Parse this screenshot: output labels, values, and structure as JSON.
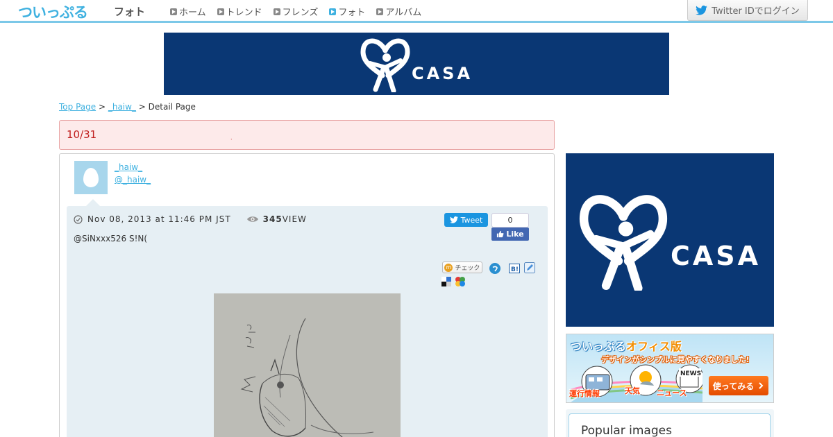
{
  "header": {
    "logo": "ついっぷる",
    "section": "フォト",
    "nav": [
      {
        "label": "ホーム",
        "active": false
      },
      {
        "label": "トレンド",
        "active": false
      },
      {
        "label": "フレンズ",
        "active": false
      },
      {
        "label": "フォト",
        "active": true
      },
      {
        "label": "アルバム",
        "active": false
      }
    ],
    "login_label": "Twitter IDでログイン"
  },
  "ads": {
    "brand": "CASA",
    "brand_color": "#0a3774",
    "office": {
      "title_prefix": "ついっぷる",
      "title_suffix": "オフィス版",
      "subtitle": "デザインがシンプルに見やすくなりました!",
      "labels": [
        "運行情報",
        "天気",
        "ニュース"
      ],
      "news_tag": "NEWS",
      "cta": "使ってみる"
    }
  },
  "breadcrumb": {
    "top": "Top Page",
    "sep": ">",
    "user": "_haiw_",
    "current": "Detail Page"
  },
  "post": {
    "title": "10/31",
    "title_dot": ".",
    "user": {
      "name": "_haiw_",
      "handle": "@_haiw_"
    },
    "timestamp": "Nov 08, 2013 at 11:46 PM JST",
    "views": "345",
    "views_label": "VIEW",
    "text": "@SiNxxx526 S!N(",
    "tweet_label": "Tweet",
    "like_count": "0",
    "like_label": "Like",
    "check_label": "チェック"
  },
  "sidebar": {
    "popular_title": "Popular images"
  },
  "colors": {
    "accent": "#3fb1e0",
    "title_red": "#c0201f",
    "twitter_blue": "#1b95e0",
    "facebook_blue": "#4267b2"
  }
}
